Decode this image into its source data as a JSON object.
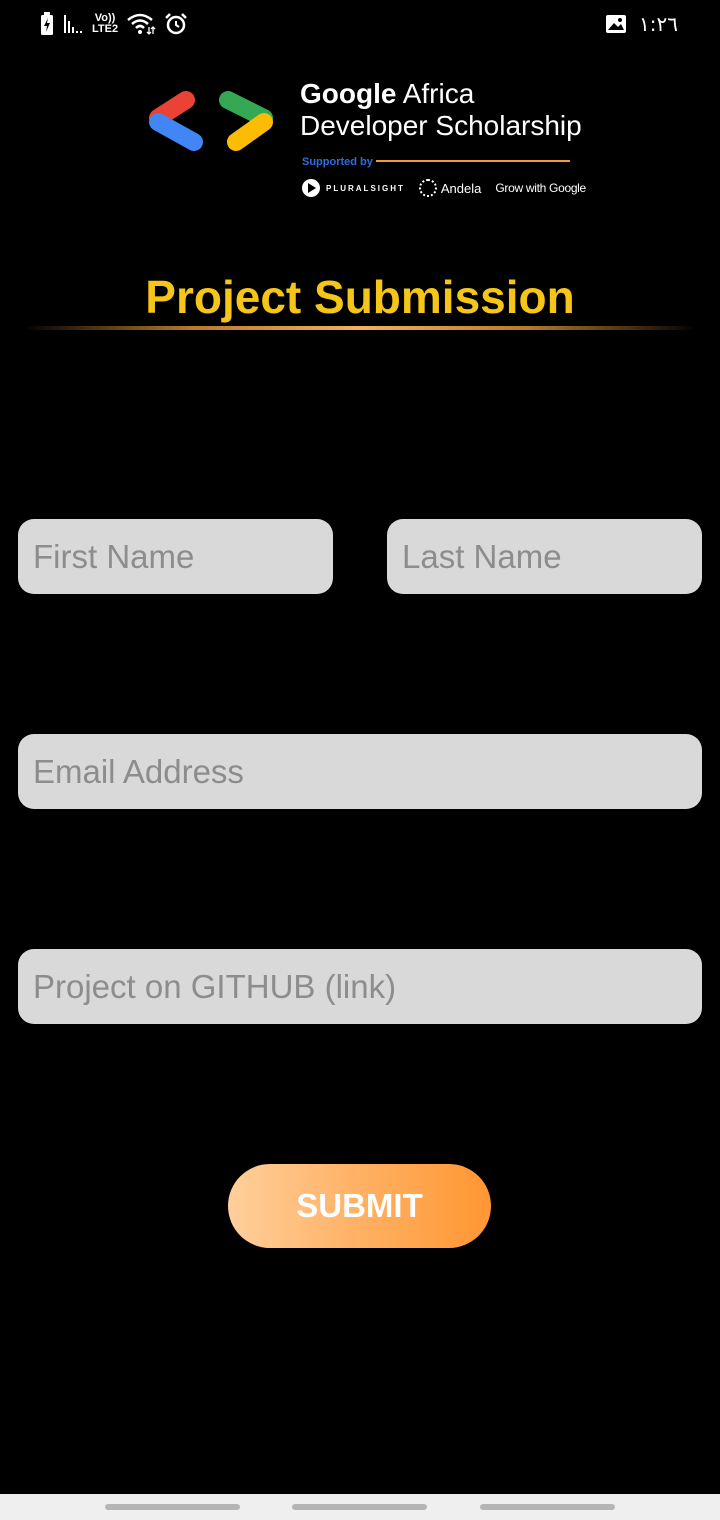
{
  "status_bar": {
    "icons": [
      "battery-charging-icon",
      "signal-icon",
      "wifi-icon",
      "alarm-icon",
      "image-icon"
    ],
    "network_top": "Vo))",
    "network_bottom": "LTE2",
    "time": "١:٢٦"
  },
  "header": {
    "brand_line1_bold": "Google",
    "brand_line1_rest": "Africa",
    "brand_line2": "Developer Scholarship",
    "supported_by": "Supported by",
    "sponsors": {
      "pluralsight": "PLURALSIGHT",
      "andela": "Andela",
      "grow_with": "Grow with",
      "google": "Google"
    },
    "logo_colors": {
      "red": "#ea4335",
      "blue": "#4285f4",
      "green": "#34a853",
      "yellow": "#fbbc04"
    }
  },
  "page": {
    "title": "Project Submission",
    "title_color": "#f5c518"
  },
  "form": {
    "first_name_placeholder": "First Name",
    "last_name_placeholder": "Last Name",
    "email_placeholder": "Email Address",
    "github_placeholder": "Project on GITHUB (link)",
    "submit_label": "SUBMIT"
  },
  "nav_bar": {
    "buttons": [
      "nav-menu-button",
      "nav-home-button",
      "nav-back-button"
    ]
  }
}
